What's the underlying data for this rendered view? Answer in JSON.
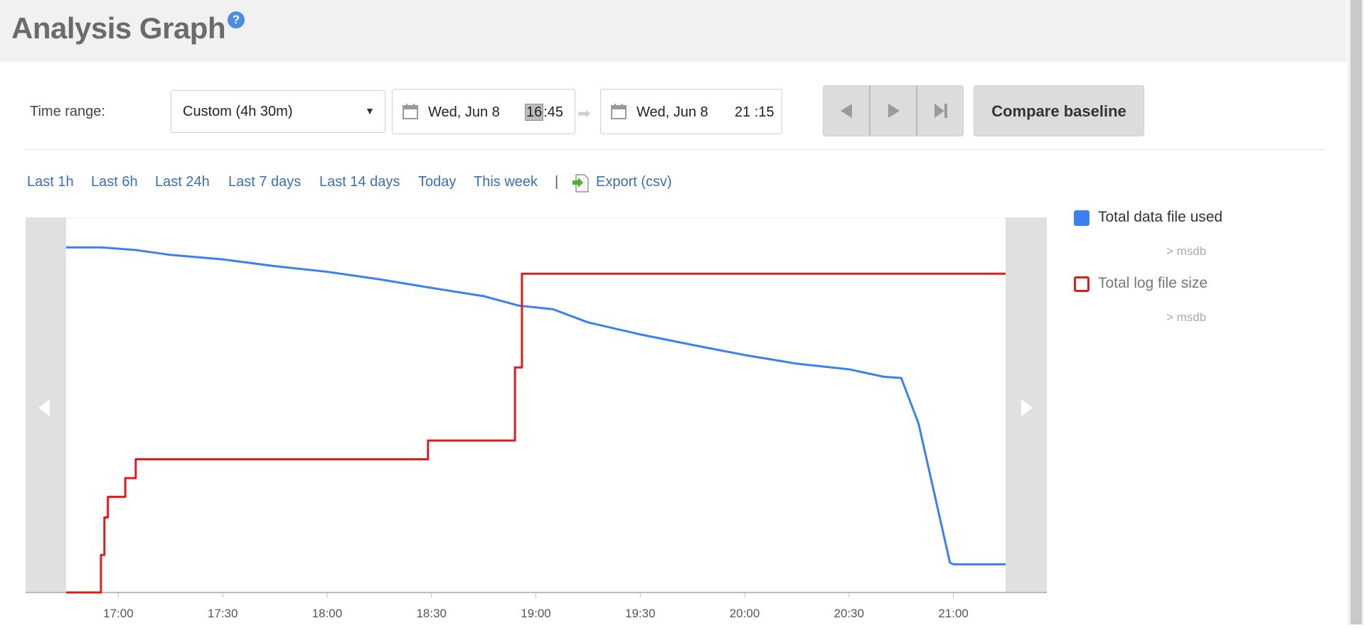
{
  "header": {
    "title": "Analysis Graph",
    "help_icon": "question-icon"
  },
  "toolbar": {
    "time_range_label": "Time range:",
    "range_select": {
      "value": "Custom (4h 30m)"
    },
    "start": {
      "date": "Wed, Jun 8",
      "time_hour": "16",
      "time_rest": ":45"
    },
    "end": {
      "date": "Wed, Jun 8",
      "time": "21 :15"
    },
    "nav_icons": [
      "prev-icon",
      "play-icon",
      "skip-end-icon"
    ],
    "compare_label": "Compare baseline"
  },
  "quick_links": [
    "Last 1h",
    "Last 6h",
    "Last 24h",
    "Last 7 days",
    "Last 14 days",
    "Today",
    "This week"
  ],
  "separator": "|",
  "export_label": "Export (csv)",
  "legend": [
    {
      "name": "Total data file used",
      "sub": "> msdb",
      "color": "#3b7ff0",
      "filled": true
    },
    {
      "name": "Total log file size",
      "sub": "> msdb",
      "color": "#e01b1b",
      "filled": false
    }
  ],
  "chart_data": {
    "type": "line",
    "x_domain": [
      "16:45",
      "21:15"
    ],
    "ylim": [
      0,
      100
    ],
    "y_axis_labels": "none",
    "grid": false,
    "legend_position": "right",
    "xticks": [
      "17:00",
      "17:30",
      "18:00",
      "18:30",
      "19:00",
      "19:30",
      "20:00",
      "20:30",
      "21:00"
    ],
    "series": [
      {
        "name": "Total data file used",
        "color": "#3b7ff0",
        "points": [
          [
            "16:45",
            92.0
          ],
          [
            "16:55",
            92.0
          ],
          [
            "17:05",
            91.3
          ],
          [
            "17:15",
            90.0
          ],
          [
            "17:30",
            88.8
          ],
          [
            "17:45",
            87.0
          ],
          [
            "18:00",
            85.5
          ],
          [
            "18:15",
            83.5
          ],
          [
            "18:30",
            81.2
          ],
          [
            "18:45",
            79.0
          ],
          [
            "18:55",
            76.5
          ],
          [
            "19:05",
            75.5
          ],
          [
            "19:15",
            72.0
          ],
          [
            "19:30",
            68.8
          ],
          [
            "19:45",
            66.0
          ],
          [
            "20:00",
            63.3
          ],
          [
            "20:15",
            61.0
          ],
          [
            "20:30",
            59.5
          ],
          [
            "20:35",
            58.5
          ],
          [
            "20:40",
            57.5
          ],
          [
            "20:45",
            57.2
          ],
          [
            "20:50",
            45.0
          ],
          [
            "20:59",
            8.0
          ],
          [
            "21:00",
            7.5
          ],
          [
            "21:15",
            7.5
          ]
        ]
      },
      {
        "name": "Total log file size",
        "color": "#e01b1b",
        "step": "post",
        "points": [
          [
            "16:45",
            0.0
          ],
          [
            "16:55",
            10.0
          ],
          [
            "16:56",
            20.0
          ],
          [
            "16:57",
            25.5
          ],
          [
            "17:02",
            30.5
          ],
          [
            "17:05",
            35.5
          ],
          [
            "18:29",
            40.5
          ],
          [
            "18:54",
            60.0
          ],
          [
            "18:56",
            85.0
          ],
          [
            "21:15",
            85.0
          ]
        ]
      }
    ]
  }
}
